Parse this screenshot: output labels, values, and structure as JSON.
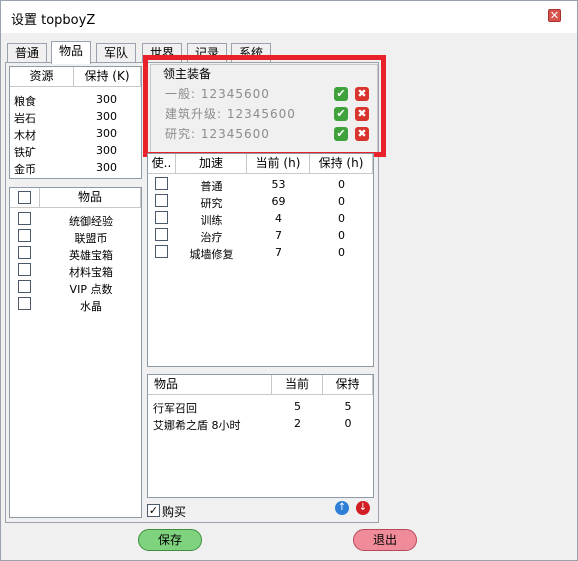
{
  "window": {
    "title": "设置 topboyZ",
    "close_glyph": "✕"
  },
  "tabs": [
    {
      "label": "普通"
    },
    {
      "label": "物品"
    },
    {
      "label": "军队"
    },
    {
      "label": "世界"
    },
    {
      "label": "记录"
    },
    {
      "label": "系统"
    }
  ],
  "resources": {
    "headers": [
      "资源",
      "保持 (K)"
    ],
    "rows": [
      {
        "name": "粮食",
        "keep": "300"
      },
      {
        "name": "岩石",
        "keep": "300"
      },
      {
        "name": "木材",
        "keep": "300"
      },
      {
        "name": "铁矿",
        "keep": "300"
      },
      {
        "name": "金币",
        "keep": "300"
      }
    ]
  },
  "items": {
    "header": "物品",
    "rows": [
      "统御经验",
      "联盟币",
      "英雄宝箱",
      "材料宝箱",
      "VIP 点数",
      "水晶"
    ]
  },
  "equipment": {
    "legend": "领主装备",
    "lines": [
      "一般: 12345600",
      "建筑升级: 12345600",
      "研究: 12345600"
    ],
    "ok_glyph": "✔",
    "x_glyph": "✖"
  },
  "speedups": {
    "headers": [
      "使..",
      "加速",
      "当前 (h)",
      "保持 (h)"
    ],
    "rows": [
      {
        "name": "普通",
        "current": "53",
        "keep": "0"
      },
      {
        "name": "研究",
        "current": "69",
        "keep": "0"
      },
      {
        "name": "训练",
        "current": "4",
        "keep": "0"
      },
      {
        "name": "治疗",
        "current": "7",
        "keep": "0"
      },
      {
        "name": "城墙修复",
        "current": "7",
        "keep": "0"
      }
    ]
  },
  "buylist": {
    "headers": [
      "物品",
      "当前",
      "保持"
    ],
    "rows": [
      {
        "name": "行军召回",
        "current": "5",
        "keep": "5"
      },
      {
        "name": "艾娜希之盾 8小时",
        "current": "2",
        "keep": "0"
      }
    ]
  },
  "buy_checkbox": {
    "label": "购买",
    "checked": true,
    "check_glyph": "✓"
  },
  "arrows": {
    "up_glyph": "↑",
    "down_glyph": "↓"
  },
  "buttons": {
    "save": "保存",
    "exit": "退出"
  },
  "colors": {
    "highlight": "#e8212b",
    "save_button": "#7fd37f",
    "exit_button": "#f08c9a",
    "arrow_up": "#2f7fd6",
    "arrow_down": "#d21d24"
  }
}
